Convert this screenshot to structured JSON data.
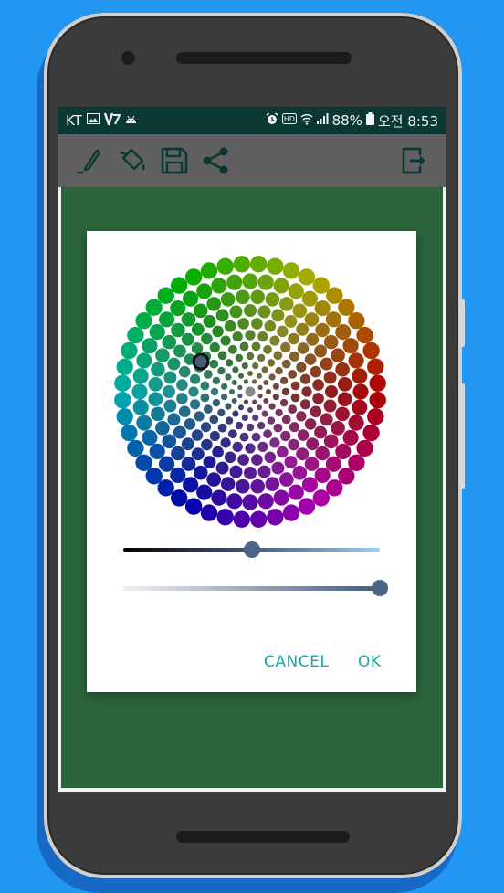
{
  "statusbar": {
    "carrier": "KT",
    "left_icons": [
      "image-icon",
      "v-app-icon",
      "android-icon"
    ],
    "right_icons": [
      "alarm-icon",
      "hd-icon",
      "wifi-icon",
      "signal-icon",
      "battery-icon"
    ],
    "battery": "88%",
    "time": "오전 8:53"
  },
  "toolbar": {
    "tools": [
      "pen-icon",
      "paint-bucket-icon",
      "save-icon",
      "share-icon"
    ],
    "exit_icon": "exit-icon",
    "background": "#666666"
  },
  "color_picker": {
    "selected_color": "#445a78",
    "lightness": 0.5,
    "alpha": 1.0,
    "cancel_label": "CANCEL",
    "ok_label": "OK",
    "accent": "#19a6a6"
  },
  "canvas": {
    "background": "#2f6b3f"
  }
}
